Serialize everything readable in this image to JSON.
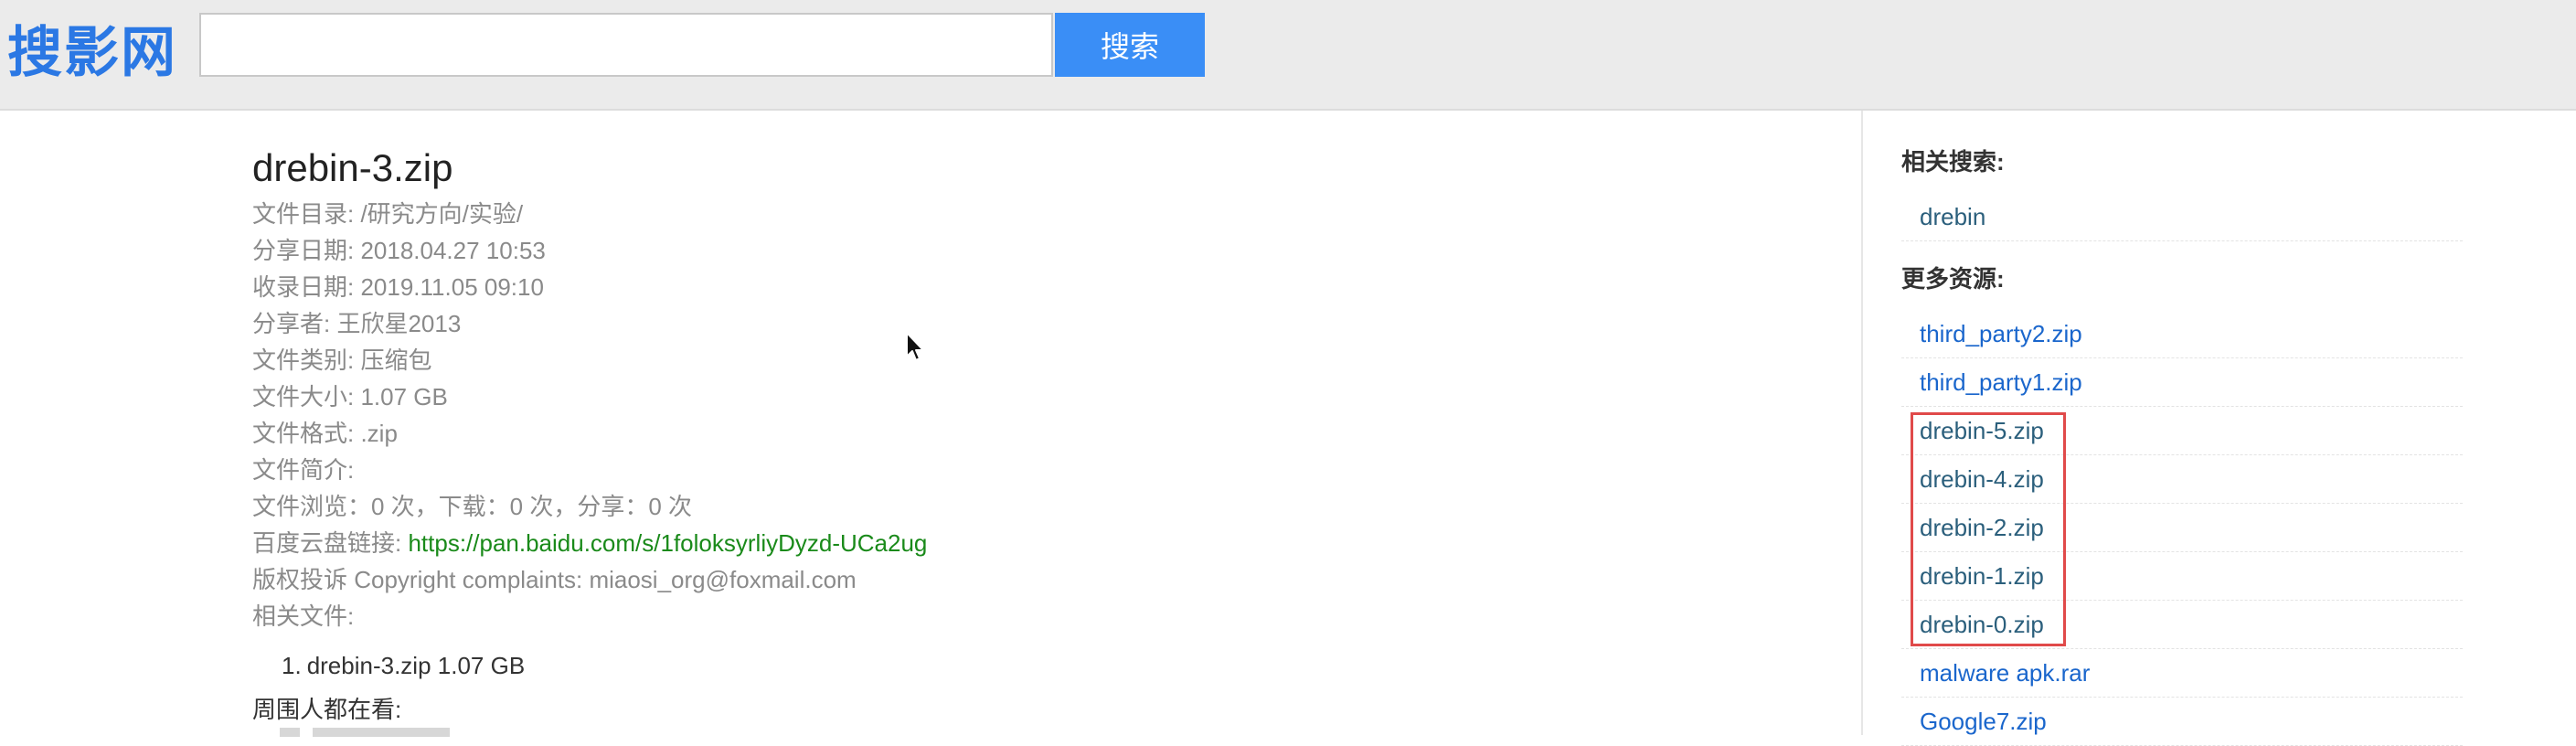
{
  "header": {
    "logo_text": "搜影网",
    "search_placeholder": "",
    "search_value": "",
    "search_button": "搜索"
  },
  "file": {
    "title": "drebin-3.zip",
    "directory_label": "文件目录: ",
    "directory": "/研究方向/实验/",
    "share_date_label": "分享日期: ",
    "share_date": "2018.04.27 10:53",
    "index_date_label": "收录日期: ",
    "index_date": "2019.11.05 09:10",
    "sharer_label": "分享者: ",
    "sharer": "王欣星2013",
    "type_label": "文件类别: ",
    "type": "压缩包",
    "size_label": "文件大小: ",
    "size": "1.07 GB",
    "format_label": "文件格式: ",
    "format": ".zip",
    "intro_label": "文件简介: ",
    "intro": "",
    "stats": "文件浏览：0 次，下载：0 次，分享：0 次",
    "baidu_label": "百度云盘链接: ",
    "baidu_link": "https://pan.baidu.com/s/1foloksyrliyDyzd-UCa2ug",
    "copyright": "版权投诉 Copyright complaints: miaosi_org@foxmail.com",
    "related_files_label": "相关文件:",
    "related_files": [
      {
        "num": "1.",
        "name": "drebin-3.zip 1.07 GB"
      }
    ],
    "around_label": "周围人都在看:"
  },
  "sidebar": {
    "related_search_heading": "相关搜索:",
    "related_searches": [
      "drebin"
    ],
    "more_resources_heading": "更多资源:",
    "more_resources": [
      {
        "label": "third_party2.zip",
        "color": "#1a66cc"
      },
      {
        "label": "third_party1.zip",
        "color": "#1a66cc"
      },
      {
        "label": "drebin-5.zip",
        "color": "#2b5f7c"
      },
      {
        "label": "drebin-4.zip",
        "color": "#2b5f7c"
      },
      {
        "label": "drebin-2.zip",
        "color": "#2b5f7c"
      },
      {
        "label": "drebin-1.zip",
        "color": "#2b5f7c"
      },
      {
        "label": "drebin-0.zip",
        "color": "#2b5f7c"
      },
      {
        "label": "malware apk.rar",
        "color": "#1a66cc"
      },
      {
        "label": "Google7.zip",
        "color": "#1a66cc"
      }
    ]
  },
  "colors": {
    "brand": "#2b78e4",
    "button": "#3a8ef6",
    "link_green": "#1a8a1a",
    "highlight_border": "#e04a4a"
  }
}
